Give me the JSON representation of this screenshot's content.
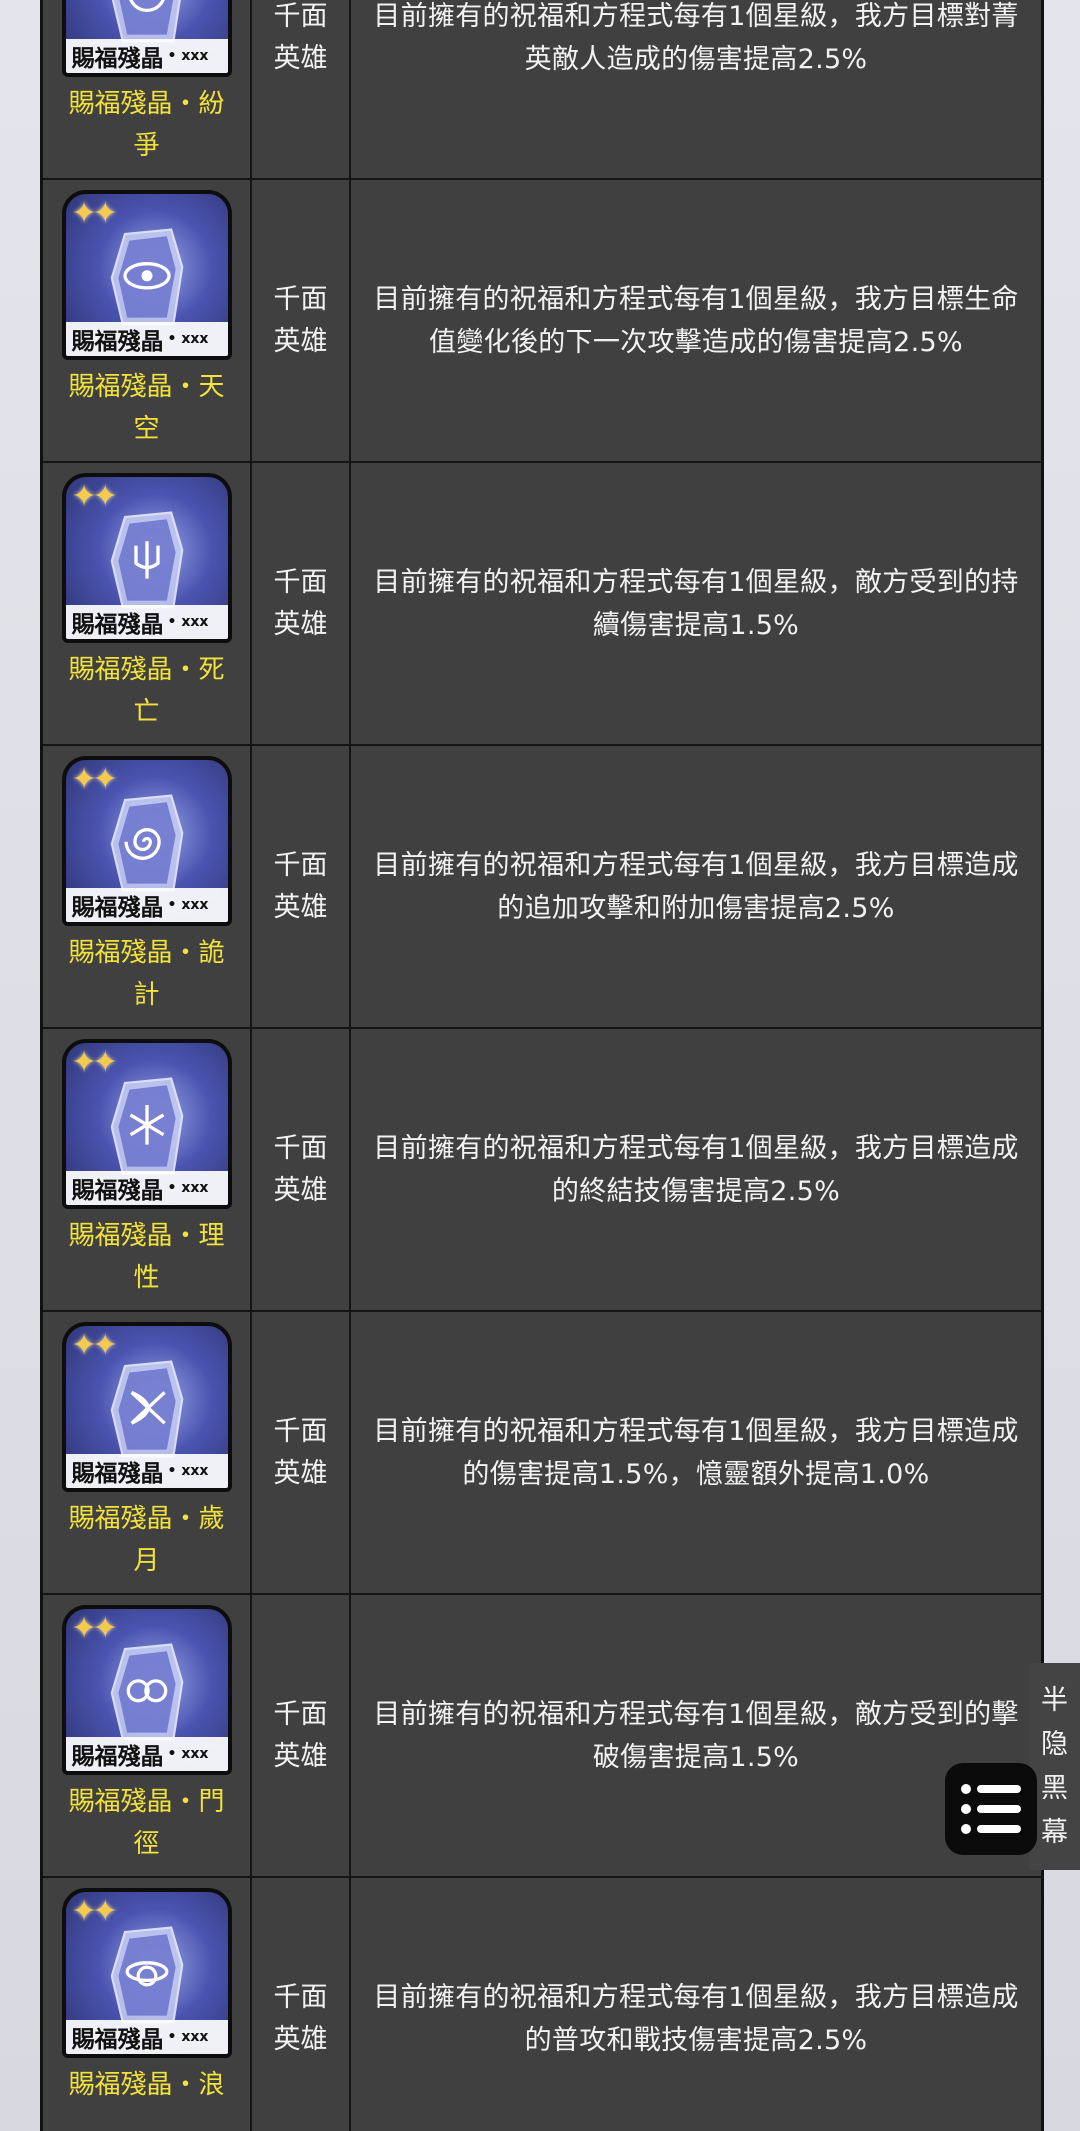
{
  "table": {
    "rows": [
      {
        "icon_label": "賜福殘晶",
        "icon_badge": "• xxx",
        "name": "賜福殘晶・紛爭",
        "type": "千面英雄",
        "description": "目前擁有的祝福和方程式每有1個星級，我方目標對菁英敵人造成的傷害提高2.5%",
        "symbol": "swirl"
      },
      {
        "icon_label": "賜福殘晶",
        "icon_badge": "• xxx",
        "name": "賜福殘晶・天空",
        "type": "千面英雄",
        "description": "目前擁有的祝福和方程式每有1個星級，我方目標生命值變化後的下一次攻擊造成的傷害提高2.5%",
        "symbol": "eye"
      },
      {
        "icon_label": "賜福殘晶",
        "icon_badge": "• xxx",
        "name": "賜福殘晶・死亡",
        "type": "千面英雄",
        "description": "目前擁有的祝福和方程式每有1個星級，敵方受到的持續傷害提高1.5%",
        "symbol": "trident"
      },
      {
        "icon_label": "賜福殘晶",
        "icon_badge": "• xxx",
        "name": "賜福殘晶・詭計",
        "type": "千面英雄",
        "description": "目前擁有的祝福和方程式每有1個星級，我方目標造成的追加攻擊和附加傷害提高2.5%",
        "symbol": "spiral"
      },
      {
        "icon_label": "賜福殘晶",
        "icon_badge": "• xxx",
        "name": "賜福殘晶・理性",
        "type": "千面英雄",
        "description": "目前擁有的祝福和方程式每有1個星級，我方目標造成的終結技傷害提高2.5%",
        "symbol": "snowflake"
      },
      {
        "icon_label": "賜福殘晶",
        "icon_badge": "• xxx",
        "name": "賜福殘晶・歲月",
        "type": "千面英雄",
        "description": "目前擁有的祝福和方程式每有1個星級，我方目標造成的傷害提高1.5%，憶靈額外提高1.0%",
        "symbol": "bow"
      },
      {
        "icon_label": "賜福殘晶",
        "icon_badge": "• xxx",
        "name": "賜福殘晶・門徑",
        "type": "千面英雄",
        "description": "目前擁有的祝福和方程式每有1個星級，敵方受到的擊破傷害提高1.5%",
        "symbol": "loops"
      },
      {
        "icon_label": "賜福殘晶",
        "icon_badge": "• xxx",
        "name": "賜福殘晶・浪",
        "type": "千面英雄",
        "description": "目前擁有的祝福和方程式每有1個星級，我方目標造成的普攻和戰技傷害提高2.5%",
        "symbol": "orbit"
      }
    ]
  },
  "side_controls": {
    "menu_icon": "list-menu-icon",
    "toggle_label": "半隐黑幕"
  },
  "colors": {
    "table_bg": "#404040",
    "item_name": "#f2e23a",
    "text": "#f2f2f2",
    "stars": "#f7c94c"
  }
}
